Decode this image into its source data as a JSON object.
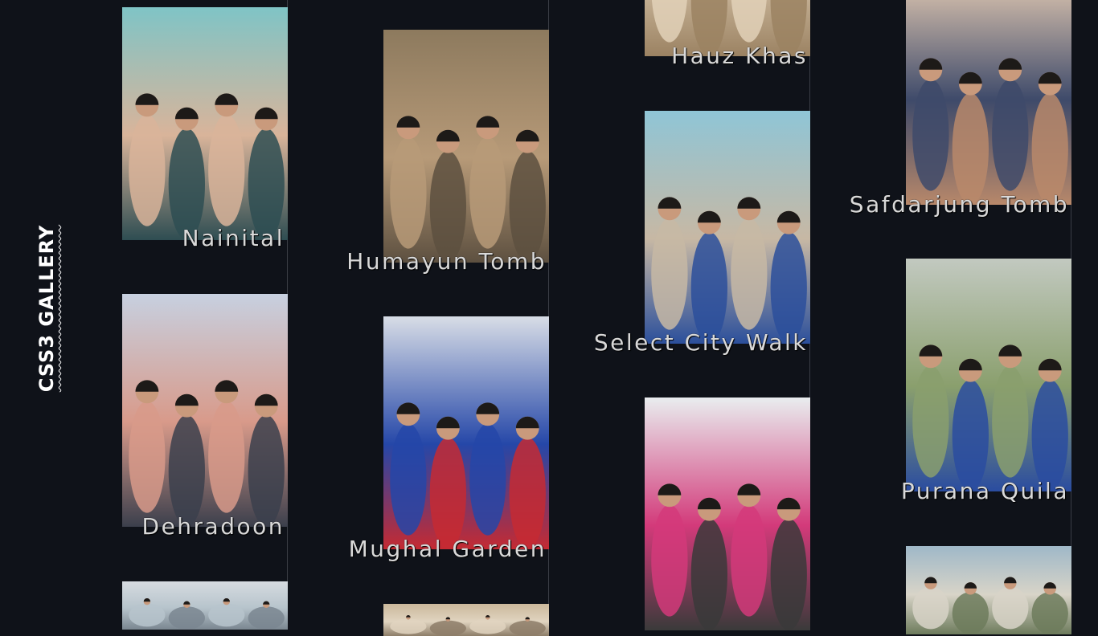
{
  "brand": {
    "title": "CSS3 GALLERY"
  },
  "gallery": {
    "items": [
      {
        "caption": "Nainital",
        "palette": [
          "#7fc4c6",
          "#2e4d52",
          "#d9b49a"
        ]
      },
      {
        "caption": "Humayun Tomb",
        "palette": [
          "#8d7a5e",
          "#5d5040",
          "#b79a78"
        ]
      },
      {
        "caption": "Hauz Khas",
        "palette": [
          "#cdb08a",
          "#9b8262",
          "#e2d1b8"
        ]
      },
      {
        "caption": "Safdarjung Tomb",
        "palette": [
          "#e7cdb4",
          "#b8886a",
          "#3e4a6a"
        ]
      },
      {
        "caption": "Select City Walk",
        "palette": [
          "#8fc5d6",
          "#2b4f9b",
          "#c7b8a4"
        ]
      },
      {
        "caption": "Dehradoon",
        "palette": [
          "#c7d0e0",
          "#3b3f4c",
          "#d89a8a"
        ]
      },
      {
        "caption": "Mughal Garden",
        "palette": [
          "#d8dde6",
          "#c52a32",
          "#2547a8"
        ]
      },
      {
        "caption": "Purana Quila",
        "palette": [
          "#c2c9c0",
          "#2a4ca0",
          "#8a9f6d"
        ]
      },
      {
        "caption": "",
        "palette": [
          "#d6dbe0",
          "#7a8690",
          "#b7c4cc"
        ]
      },
      {
        "caption": "",
        "palette": [
          "#e9edef",
          "#3a3a3a",
          "#d33a7a"
        ]
      },
      {
        "caption": "",
        "palette": [
          "#9fb8c8",
          "#6d7b5c",
          "#d8d4c8"
        ]
      },
      {
        "caption": "",
        "palette": [
          "#cbb89b",
          "#8d7d68",
          "#e0d4c0"
        ]
      }
    ]
  }
}
